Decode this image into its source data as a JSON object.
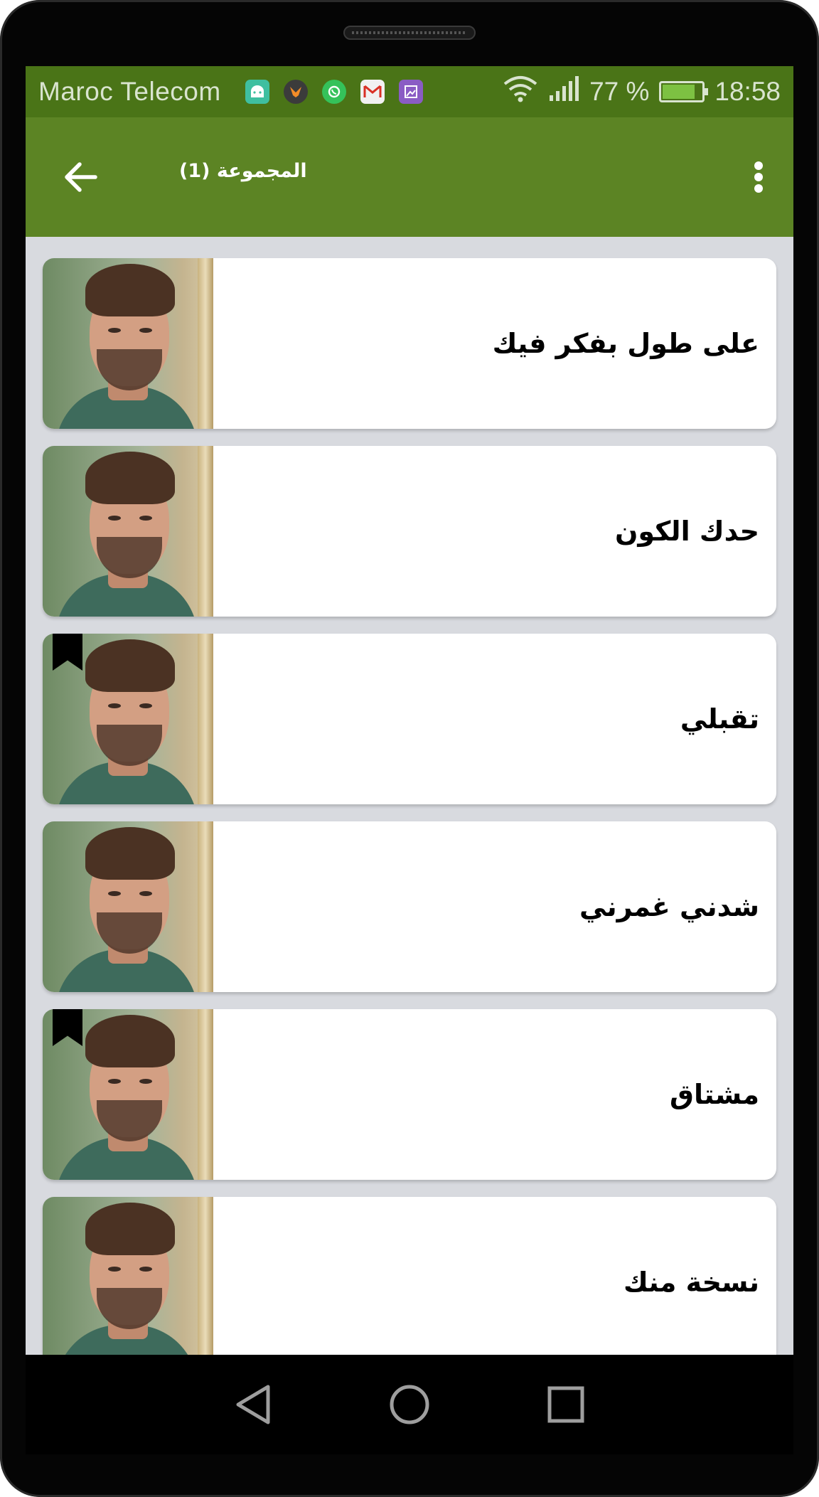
{
  "status_bar": {
    "carrier": "Maroc Telecom",
    "battery_percent": "77 %",
    "battery_level": 0.77,
    "time": "18:58",
    "notification_icons": [
      "android-icon",
      "fox-app-icon",
      "whatsapp-icon",
      "gmail-icon",
      "gallery-icon"
    ]
  },
  "app_bar": {
    "title": "المجموعة (1)",
    "back_icon": "arrow-left-icon",
    "menu_icon": "more-vert-icon"
  },
  "songs": [
    {
      "title": "على طول بفكر فيك",
      "bookmarked": false
    },
    {
      "title": "حدك الكون",
      "bookmarked": false
    },
    {
      "title": "تقبلي",
      "bookmarked": true
    },
    {
      "title": "شدني غمرني",
      "bookmarked": false
    },
    {
      "title": "مشتاق",
      "bookmarked": true
    },
    {
      "title": "نسخة منك",
      "bookmarked": false
    }
  ],
  "nav_bar": {
    "icons": [
      "back-triangle-icon",
      "home-circle-icon",
      "recents-square-icon"
    ]
  },
  "colors": {
    "status_bar": "#4a7417",
    "app_bar": "#5c8424",
    "list_background": "#d8dadf"
  }
}
